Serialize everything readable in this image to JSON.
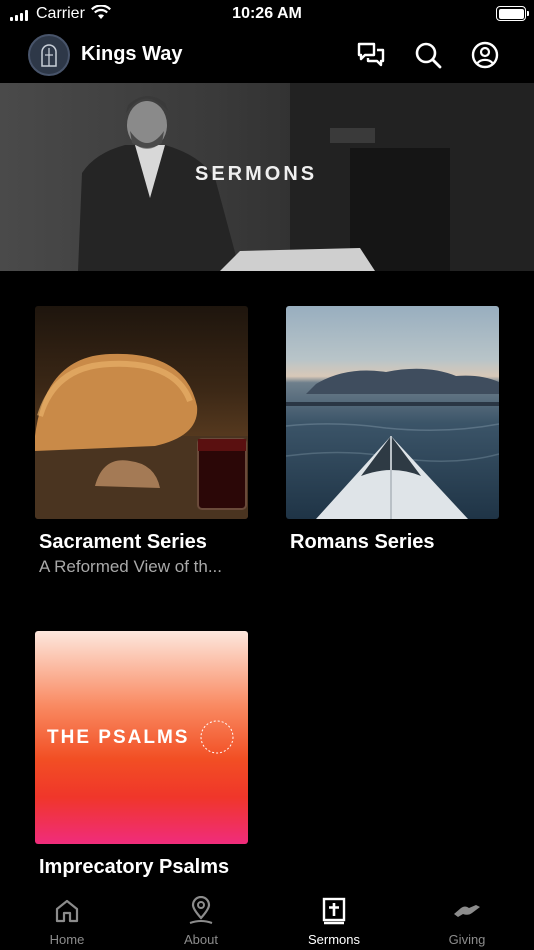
{
  "status_bar": {
    "carrier": "Carrier",
    "time": "10:26 AM"
  },
  "header": {
    "title": "Kings Way",
    "icons": [
      "chat-icon",
      "search-icon",
      "account-icon"
    ]
  },
  "hero": {
    "title": "SERMONS"
  },
  "series": [
    {
      "title": "Sacrament Series",
      "subtitle": "A Reformed View of th..."
    },
    {
      "title": "Romans Series",
      "subtitle": ""
    },
    {
      "title": "Imprecatory Psalms",
      "subtitle": "",
      "thumb_text": "THE PSALMS"
    }
  ],
  "tabs": [
    {
      "label": "Home",
      "icon": "home-icon",
      "active": false
    },
    {
      "label": "About",
      "icon": "location-pin-icon",
      "active": false
    },
    {
      "label": "Sermons",
      "icon": "bible-icon",
      "active": true
    },
    {
      "label": "Giving",
      "icon": "giving-hand-icon",
      "active": false
    }
  ],
  "colors": {
    "background": "#000000",
    "active_tab": "#ffffff",
    "inactive_tab": "#8c8c8c",
    "subtitle": "#a9a9a9"
  }
}
